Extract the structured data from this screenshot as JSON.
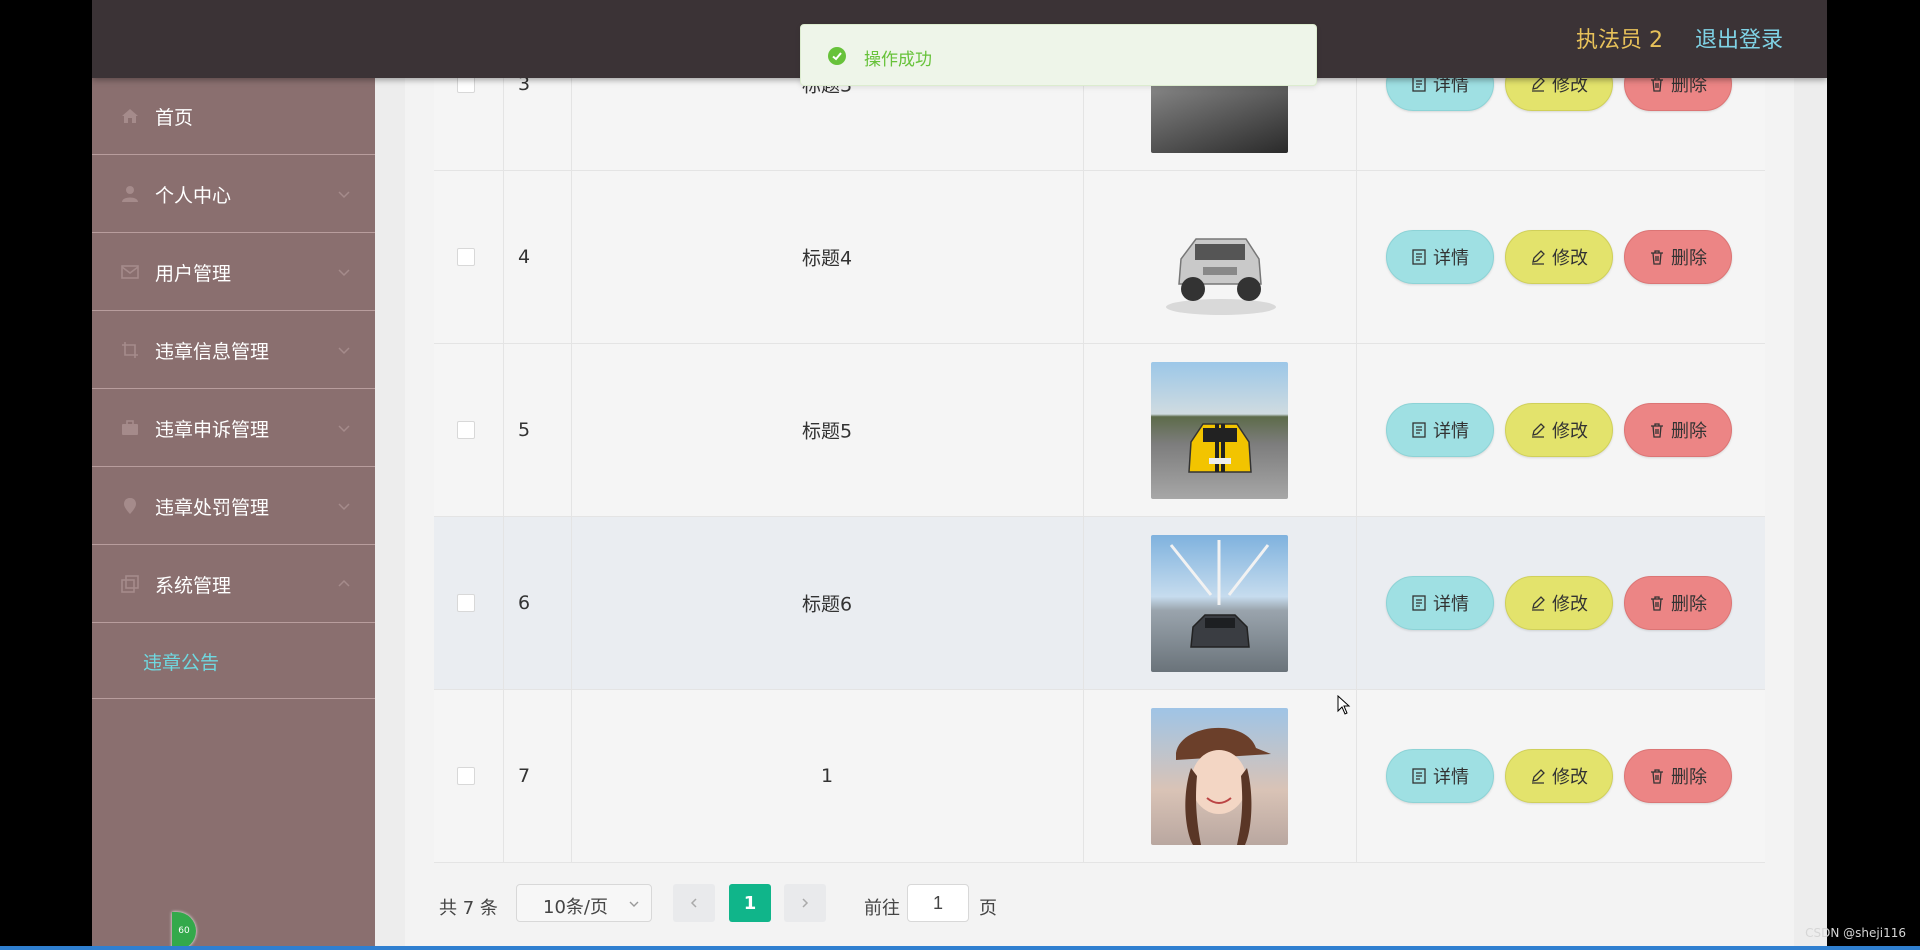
{
  "header": {
    "user_name": "执法员 2",
    "logout_label": "退出登录"
  },
  "toast": {
    "message": "操作成功"
  },
  "sidebar": {
    "items": [
      {
        "label": "首页",
        "icon": "home-icon"
      },
      {
        "label": "个人中心",
        "icon": "user-icon"
      },
      {
        "label": "用户管理",
        "icon": "mail-icon"
      },
      {
        "label": "违章信息管理",
        "icon": "crop-icon"
      },
      {
        "label": "违章申诉管理",
        "icon": "briefcase-icon"
      },
      {
        "label": "违章处罚管理",
        "icon": "location-icon"
      },
      {
        "label": "系统管理",
        "icon": "copy-icon"
      }
    ],
    "submenu": {
      "label": "违章公告"
    },
    "badge": "60"
  },
  "table": {
    "rows": [
      {
        "index": "3",
        "title": "标题3",
        "image": "silver-car-photo"
      },
      {
        "index": "4",
        "title": "标题4",
        "image": "suv-photo"
      },
      {
        "index": "5",
        "title": "标题5",
        "image": "yellow-camaro-photo"
      },
      {
        "index": "6",
        "title": "标题6",
        "image": "bridge-car-photo"
      },
      {
        "index": "7",
        "title": "1",
        "image": "girl-cap-photo"
      }
    ],
    "actions": {
      "detail": "详情",
      "edit": "修改",
      "delete": "删除"
    }
  },
  "pagination": {
    "total": "共 7 条",
    "page_size": "10条/页",
    "current_page": "1",
    "goto_label": "前往",
    "goto_value": "1",
    "goto_suffix": "页"
  },
  "watermark": "CSDN @sheji116",
  "colors": {
    "topbar": "#3b3336",
    "sidebar": "#8a6f6f",
    "accent_green": "#10b58a",
    "detail_btn": "#9fe0e3",
    "edit_btn": "#e3e36c",
    "delete_btn": "#ec8585"
  }
}
